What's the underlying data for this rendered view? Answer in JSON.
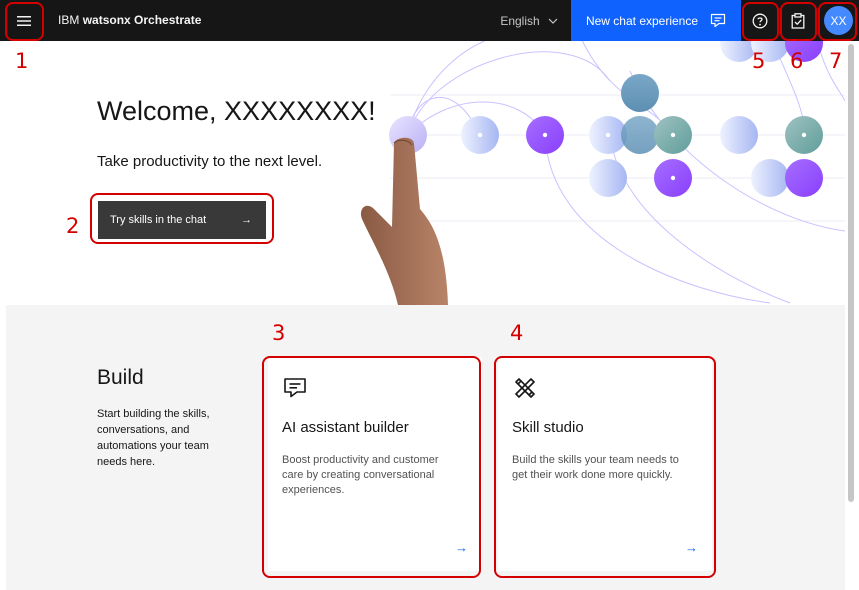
{
  "header": {
    "brand_prefix": "IBM",
    "brand_name": "watsonx Orchestrate",
    "language": "English",
    "new_chat_label": "New chat experience",
    "avatar_initials": "XX"
  },
  "hero": {
    "welcome": "Welcome, XXXXXXXX!",
    "subtitle": "Take productivity to the next level.",
    "cta_label": "Try skills in the chat",
    "cta_arrow": "→"
  },
  "build": {
    "title": "Build",
    "description": "Start building the skills, conversations, and automations your team needs here."
  },
  "cards": [
    {
      "title": "AI assistant builder",
      "description": "Boost productivity and customer care by creating conversational experiences.",
      "arrow": "→",
      "icon": "chat-icon"
    },
    {
      "title": "Skill studio",
      "description": "Build the skills your team needs to get their work done more quickly.",
      "arrow": "→",
      "icon": "tools-icon"
    }
  ],
  "annotations": [
    "1",
    "2",
    "3",
    "4",
    "5",
    "6",
    "7"
  ],
  "colors": {
    "header_bg": "#161616",
    "accent_blue": "#0f62fe",
    "cta_bg": "#393939",
    "section_bg": "#f4f4f4",
    "annotation_red": "#d40000",
    "avatar_bg": "#4589ff"
  }
}
